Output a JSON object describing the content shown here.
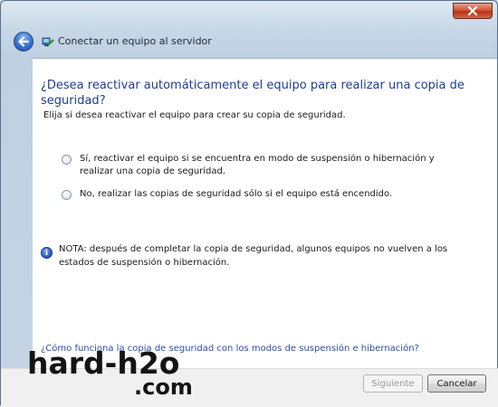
{
  "window": {
    "title": "Conectar un equipo al servidor",
    "close_icon": "close-icon",
    "back_icon": "back-arrow-icon"
  },
  "content": {
    "heading": "¿Desea reactivar automáticamente el equipo para realizar una copia de seguridad?",
    "subheading": "Elija si desea reactivar el equipo para crear su copia de seguridad.",
    "options": [
      {
        "label": "Sí, reactivar el equipo si se encuentra en modo de suspensión o hibernación y realizar una copia de seguridad.",
        "selected": false
      },
      {
        "label": "No, realizar las copias de seguridad sólo si el equipo está encendido.",
        "selected": false
      }
    ],
    "note": "NOTA: después de completar la copia de seguridad, algunos equipos no vuelven a los estados de suspensión o hibernación.",
    "help_link": "¿Cómo funciona la copia de seguridad con los modos de suspensión e hibernación?"
  },
  "buttons": {
    "next_label": "Siguiente",
    "next_enabled": false,
    "cancel_label": "Cancelar"
  },
  "watermark": {
    "line1": "hard-h2o",
    "line2": ".com"
  },
  "colors": {
    "heading": "#1f3c94",
    "link": "#2a4ea8",
    "close_button": "#c4401f"
  }
}
